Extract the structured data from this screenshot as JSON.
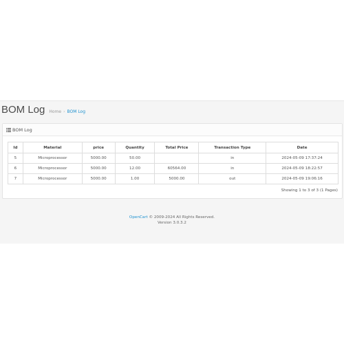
{
  "page": {
    "title": "BOM Log",
    "breadcrumb": {
      "home": "Home",
      "separator": "›",
      "current": "BOM Log"
    }
  },
  "panel": {
    "heading": "BOM Log",
    "icon": "list-icon",
    "columns": [
      "Id",
      "Material",
      "price",
      "Quantity",
      "Total Price",
      "Transaction Type",
      "Date"
    ],
    "rows": [
      [
        "5",
        "Microprocessor",
        "5000.00",
        "50.00",
        "",
        "in",
        "2024-05-09 17:37:24"
      ],
      [
        "6",
        "Microprocessor",
        "5000.00",
        "12.00",
        "60564.00",
        "in",
        "2024-05-09 18:22:57"
      ],
      [
        "7",
        "Microprocessor",
        "5000.00",
        "1.00",
        "5000.00",
        "out",
        "2024-05-09 19:06:16"
      ]
    ],
    "results": "Showing 1 to 3 of 3 (1 Pages)"
  },
  "footer": {
    "brand": "OpenCart",
    "copyright": " © 2009-2024 All Rights Reserved.",
    "version": "Version 3.0.3.2"
  },
  "colors": {
    "link": "#1e91cf",
    "background": "#f5f5f5"
  }
}
